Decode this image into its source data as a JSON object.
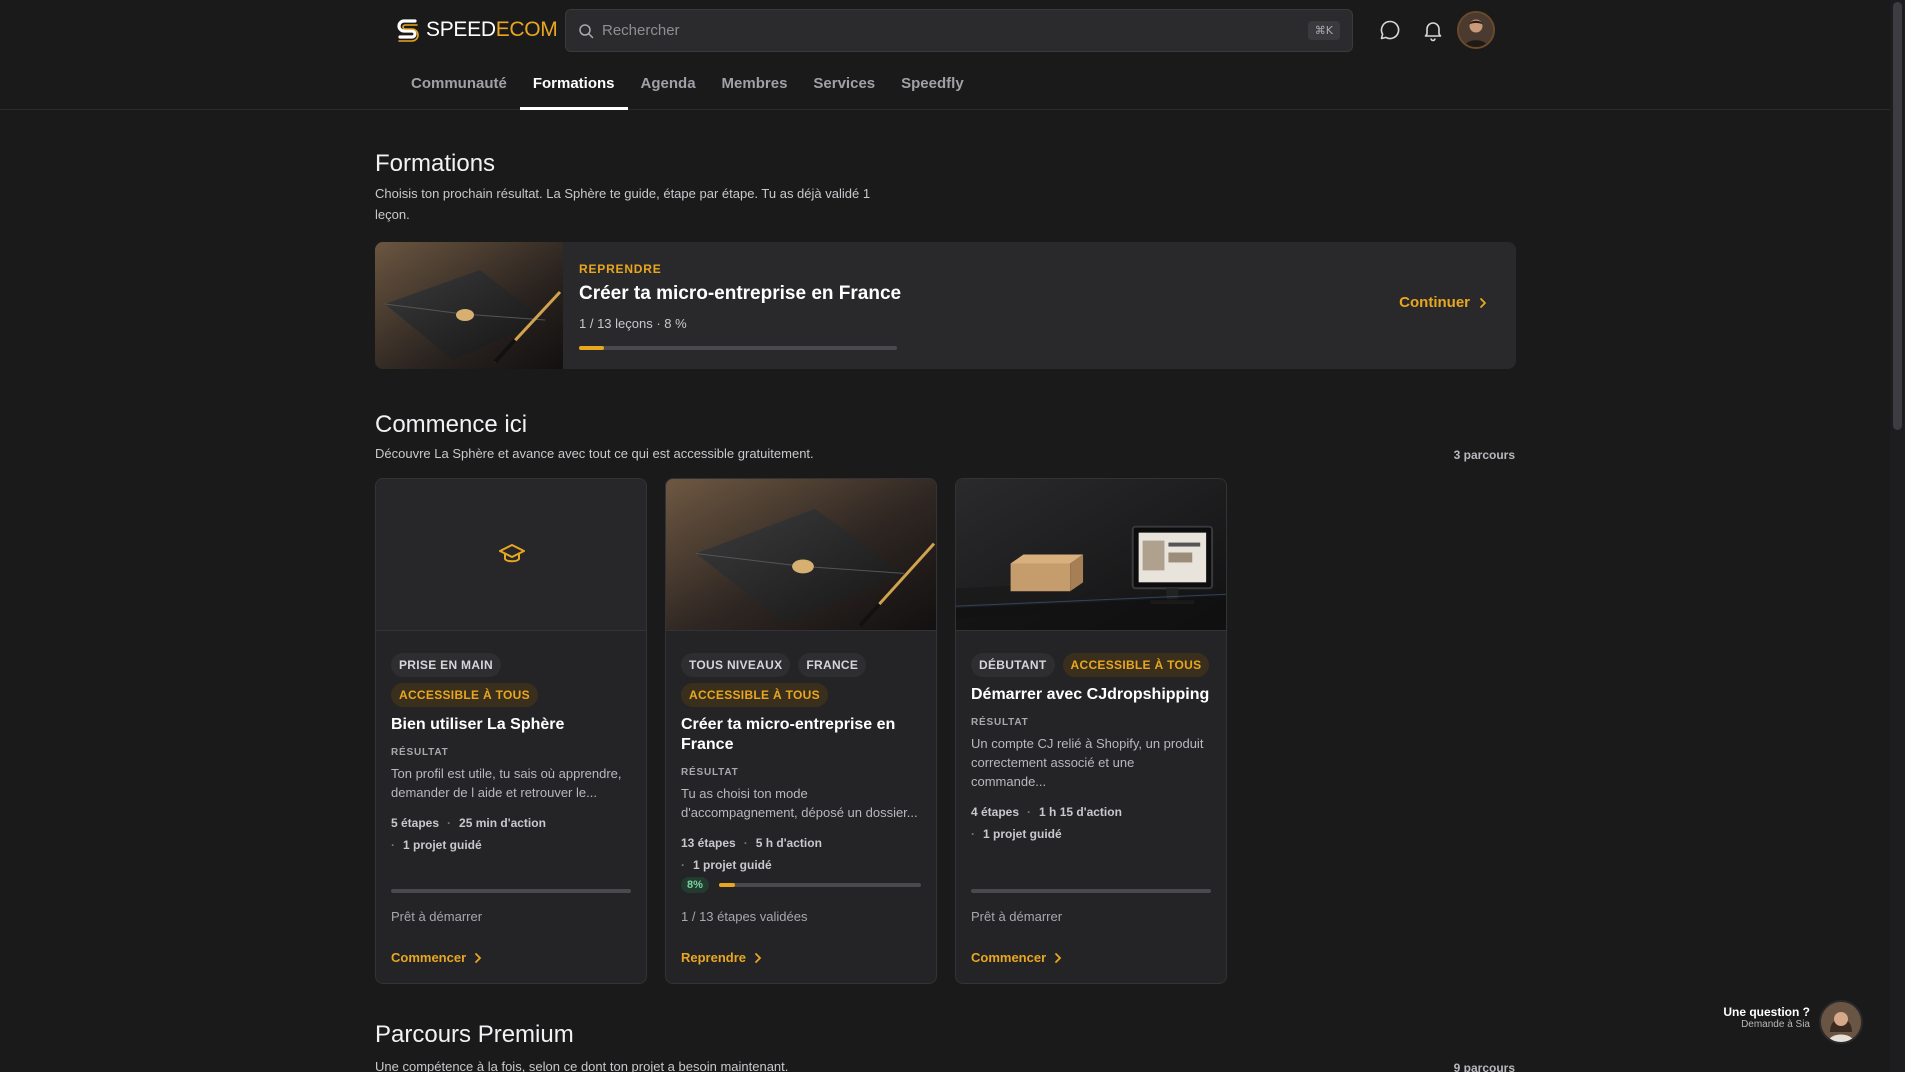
{
  "brand": {
    "name_a": "SPEED",
    "name_b": "ECOM",
    "accent": "#e9a720"
  },
  "search": {
    "placeholder": "Rechercher",
    "shortcut": "⌘K"
  },
  "nav": {
    "tabs": [
      {
        "label": "Communauté"
      },
      {
        "label": "Formations",
        "active": true
      },
      {
        "label": "Agenda"
      },
      {
        "label": "Membres"
      },
      {
        "label": "Services"
      },
      {
        "label": "Speedfly"
      }
    ]
  },
  "formations": {
    "title": "Formations",
    "subtitle_line1": "Choisis ton prochain résultat. La Sphère te guide, étape par étape. Tu as déjà validé 1",
    "subtitle_line2": "leçon."
  },
  "resume": {
    "eyebrow": "REPRENDRE",
    "title": "Créer ta micro-entreprise en France",
    "meta": "1 / 13 leçons · 8 %",
    "progress": 0.08,
    "cta": "Continuer"
  },
  "start": {
    "title": "Commence ici",
    "subtitle": "Découvre La Sphère et avance avec tout ce qui est accessible gratuitement.",
    "count": "3 parcours",
    "cards": [
      {
        "media": "graduation-cap-icon",
        "tags": [
          "PRISE EN MAIN"
        ],
        "tags2": [
          "ACCESSIBLE À TOUS"
        ],
        "title": "Bien utiliser La Sphère",
        "label": "RÉSULTAT",
        "desc_line1": "Ton profil est utile, tu sais où apprendre,",
        "desc_line2": "demander de l aide et retrouver le...",
        "fact1": "5 étapes",
        "fact2": "25 min d'action",
        "fact3": "1 projet guidé",
        "status": "Prêt à démarrer",
        "cta": "Commencer"
      },
      {
        "media": "notebook-photo",
        "tags": [
          "TOUS NIVEAUX",
          "FRANCE"
        ],
        "tags2": [
          "ACCESSIBLE À TOUS"
        ],
        "title_line1": "Créer ta micro-entreprise en",
        "title_line2": "France",
        "label": "RÉSULTAT",
        "desc_line1": "Tu as choisi ton mode",
        "desc_line2": "d'accompagnement, déposé un dossier...",
        "fact1": "13 étapes",
        "fact2": "5 h d'action",
        "fact3": "1 projet guidé",
        "progress_pct": "8%",
        "progress": 0.08,
        "status": "1 / 13 étapes validées",
        "cta": "Reprendre"
      },
      {
        "media": "dropshipping-photo",
        "tags": [
          "DÉBUTANT"
        ],
        "tags_gold": [
          "ACCESSIBLE À TOUS"
        ],
        "title": "Démarrer avec CJdropshipping",
        "label": "RÉSULTAT",
        "desc_line1": "Un compte CJ relié à Shopify, un produit",
        "desc_line2": "correctement associé et une commande...",
        "fact1": "4 étapes",
        "fact2": "1 h 15 d'action",
        "fact3": "1 projet guidé",
        "status": "Prêt à démarrer",
        "cta": "Commencer"
      }
    ]
  },
  "premium": {
    "title": "Parcours Premium",
    "subtitle": "Une compétence à la fois, selon ce dont ton projet a besoin maintenant.",
    "count": "9 parcours"
  },
  "help": {
    "question": "Une question ?",
    "answer": "Demande à Sia"
  }
}
